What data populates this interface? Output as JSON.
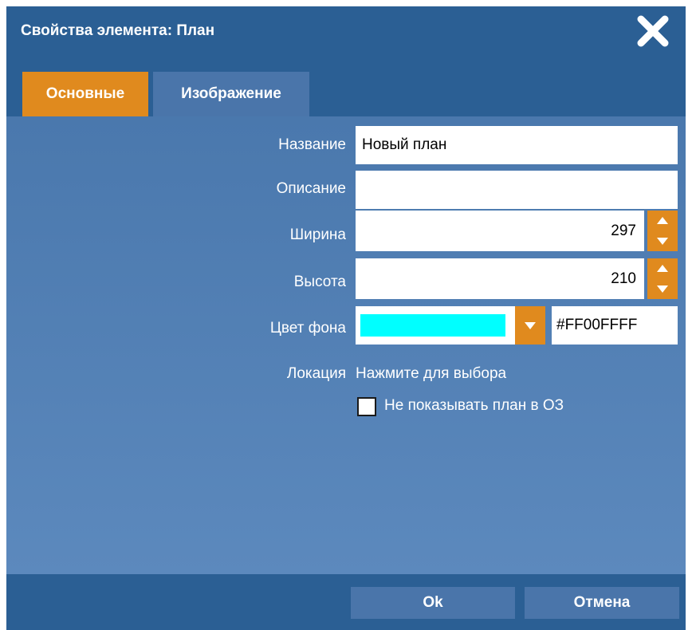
{
  "dialog": {
    "title": "Свойства элемента: План"
  },
  "tabs": [
    {
      "label": "Основные",
      "active": true
    },
    {
      "label": "Изображение",
      "active": false
    }
  ],
  "form": {
    "name_label": "Название",
    "name_value": "Новый план",
    "description_label": "Описание",
    "description_value": "",
    "width_label": "Ширина",
    "width_value": "297",
    "height_label": "Высота",
    "height_value": "210",
    "bgcolor_label": "Цвет фона",
    "bgcolor_hex": "#FF00FFFF",
    "bgcolor_swatch": "#00ffff",
    "location_label": "Локация",
    "location_link": "Нажмите для выбора",
    "hide_checkbox_label": "Не показывать план в ОЗ",
    "hide_checked": false
  },
  "buttons": {
    "ok": "Ok",
    "cancel": "Отмена"
  },
  "colors": {
    "titlebar": "#2b5f94",
    "accent": "#e08a1e",
    "tab_inactive": "#4a75aa",
    "panel": "#5c89bd"
  },
  "icons": {
    "close": "close-icon",
    "spin_up": "chevron-up-icon",
    "spin_down": "chevron-down-icon",
    "dropdown": "chevron-down-icon"
  }
}
